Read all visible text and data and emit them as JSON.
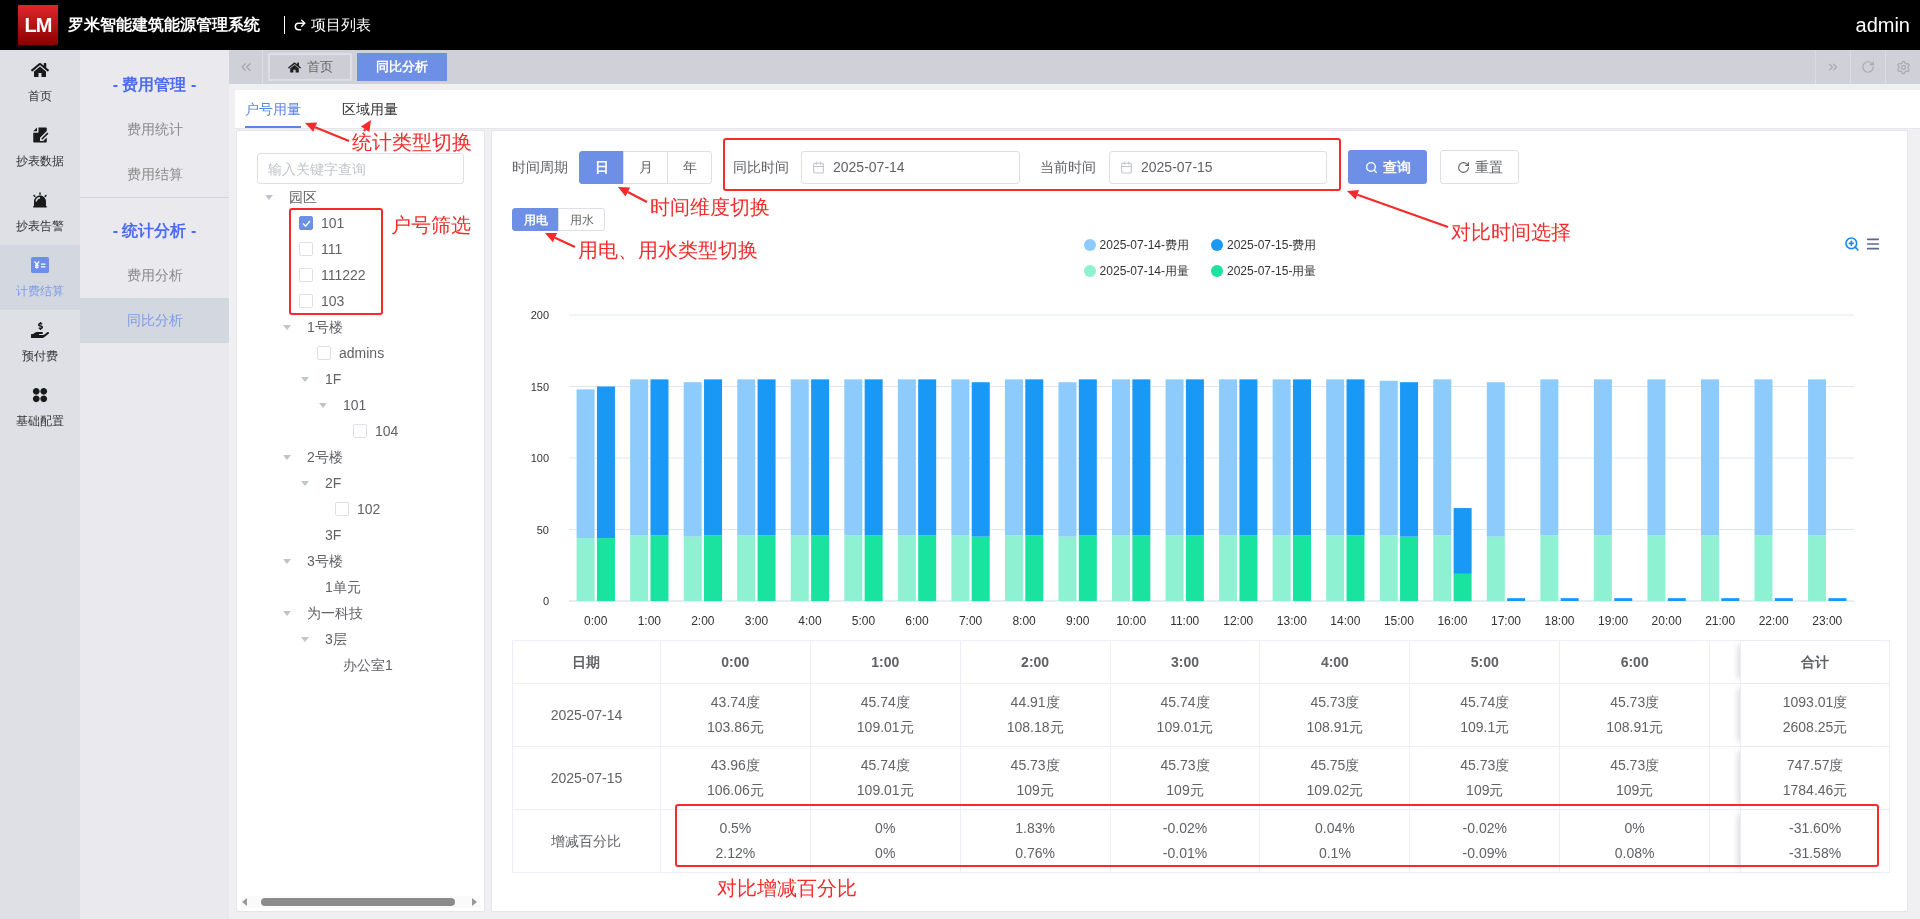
{
  "header": {
    "logo": "LM",
    "title": "罗米智能建筑能源管理系统",
    "project_link": "项目列表",
    "user": "admin"
  },
  "nav": [
    {
      "label": "首页",
      "selected": false
    },
    {
      "label": "抄表数据",
      "selected": false
    },
    {
      "label": "抄表告警",
      "selected": false
    },
    {
      "label": "计费结算",
      "selected": true
    },
    {
      "label": "预付费",
      "selected": false
    },
    {
      "label": "基础配置",
      "selected": false
    }
  ],
  "subnav": [
    {
      "heading": "- 费用管理 -",
      "items": [
        {
          "label": "费用统计",
          "selected": false
        },
        {
          "label": "费用结算",
          "selected": false
        }
      ]
    },
    {
      "heading": "- 统计分析 -",
      "items": [
        {
          "label": "费用分析",
          "selected": false
        },
        {
          "label": "同比分析",
          "selected": true
        }
      ]
    }
  ],
  "tab_bar": {
    "tabs": [
      {
        "label": "首页",
        "selected": false
      },
      {
        "label": "同比分析",
        "selected": true
      }
    ]
  },
  "view_tabs": [
    {
      "label": "户号用量",
      "selected": true
    },
    {
      "label": "区域用量",
      "selected": false
    }
  ],
  "tree": {
    "search": {
      "placeholder": "输入关键字查询"
    },
    "nodes": [
      {
        "label": "园区",
        "kind": "group",
        "expanded": true,
        "children": [
          {
            "label": "101",
            "kind": "unit",
            "checked": true
          },
          {
            "label": "111",
            "kind": "unit",
            "checked": false
          },
          {
            "label": "111222",
            "kind": "unit",
            "checked": false
          },
          {
            "label": "103",
            "kind": "unit",
            "checked": false
          },
          {
            "label": "1号楼",
            "kind": "group",
            "expanded": true,
            "children": [
              {
                "label": "admins",
                "kind": "unit",
                "checked": false
              },
              {
                "label": "1F",
                "kind": "group",
                "expanded": true,
                "children": [
                  {
                    "label": "101",
                    "kind": "group",
                    "expanded": true,
                    "children": [
                      {
                        "label": "104",
                        "kind": "unit",
                        "checked": false
                      }
                    ]
                  }
                ]
              }
            ]
          },
          {
            "label": "2号楼",
            "kind": "group",
            "expanded": true,
            "children": [
              {
                "label": "2F",
                "kind": "group",
                "expanded": true,
                "children": [
                  {
                    "label": "102",
                    "kind": "unit",
                    "checked": false
                  }
                ]
              },
              {
                "label": "3F",
                "kind": "group"
              }
            ]
          },
          {
            "label": "3号楼",
            "kind": "group",
            "expanded": true,
            "children": [
              {
                "label": "1单元",
                "kind": "group"
              }
            ]
          },
          {
            "label": "为一科技",
            "kind": "group",
            "expanded": true,
            "children": [
              {
                "label": "3层",
                "kind": "group",
                "expanded": true,
                "children": [
                  {
                    "label": "办公室1",
                    "kind": "group"
                  }
                ]
              }
            ]
          }
        ]
      }
    ]
  },
  "filters": {
    "period_label": "时间周期",
    "periods": [
      {
        "label": "日",
        "selected": true
      },
      {
        "label": "月",
        "selected": false
      },
      {
        "label": "年",
        "selected": false
      }
    ],
    "compare_label": "同比时间",
    "compare_date": "2025-07-14",
    "current_label": "当前时间",
    "current_date": "2025-07-15",
    "query_button": "查询",
    "reset_button": "重置",
    "energy_types": [
      {
        "label": "用电",
        "selected": true
      },
      {
        "label": "用水",
        "selected": false
      }
    ]
  },
  "chart": {
    "chart_data": {
      "type": "bar",
      "stacked": true,
      "legend": "top",
      "grid": true,
      "x": [
        -0.19,
        0.19,
        0.81,
        1.19,
        1.81,
        2.19,
        2.81,
        3.19,
        3.81,
        4.19,
        4.81,
        5.19,
        5.81,
        6.19,
        6.81,
        7.19,
        7.81,
        8.19,
        8.81,
        9.19,
        9.81,
        10.19,
        10.81,
        11.19,
        11.81,
        12.19,
        12.81,
        13.19,
        13.81,
        14.19,
        14.81,
        15.19,
        15.81,
        16.19,
        16.81,
        17.19,
        17.81,
        18.19,
        18.81,
        19.19,
        19.81,
        20.19,
        20.81,
        21.19,
        21.81,
        22.19,
        22.81,
        23.19
      ],
      "xlim": [
        -0.5,
        23.5
      ],
      "xticks": [
        {
          "value": 0,
          "label": "0:00"
        },
        {
          "value": 1,
          "label": "1:00"
        },
        {
          "value": 2,
          "label": "2:00"
        },
        {
          "value": 3,
          "label": "3:00"
        },
        {
          "value": 4,
          "label": "4:00"
        },
        {
          "value": 5,
          "label": "5:00"
        },
        {
          "value": 6,
          "label": "6:00"
        },
        {
          "value": 7,
          "label": "7:00"
        },
        {
          "value": 8,
          "label": "8:00"
        },
        {
          "value": 9,
          "label": "9:00"
        },
        {
          "value": 10,
          "label": "10:00"
        },
        {
          "value": 11,
          "label": "11:00"
        },
        {
          "value": 12,
          "label": "12:00"
        },
        {
          "value": 13,
          "label": "13:00"
        },
        {
          "value": 14,
          "label": "14:00"
        },
        {
          "value": 15,
          "label": "15:00"
        },
        {
          "value": 16,
          "label": "16:00"
        },
        {
          "value": 17,
          "label": "17:00"
        },
        {
          "value": 18,
          "label": "18:00"
        },
        {
          "value": 19,
          "label": "19:00"
        },
        {
          "value": 20,
          "label": "20:00"
        },
        {
          "value": 21,
          "label": "21:00"
        },
        {
          "value": 22,
          "label": "22:00"
        },
        {
          "value": 23,
          "label": "23:00"
        }
      ],
      "series": [
        {
          "name": "2025-07-14-用量",
          "color": "#8ef1d2",
          "values": [
            44,
            null,
            46,
            null,
            45,
            null,
            46,
            null,
            46,
            null,
            46,
            null,
            46,
            null,
            46,
            null,
            46,
            null,
            45,
            null,
            46,
            null,
            46,
            null,
            46,
            null,
            46,
            null,
            46,
            null,
            46,
            null,
            46,
            null,
            45,
            null,
            46,
            null,
            46,
            null,
            46,
            null,
            46,
            null,
            46,
            null,
            46,
            null
          ]
        },
        {
          "name": "2025-07-15-用量",
          "color": "#19e39f",
          "values": [
            null,
            44,
            null,
            46,
            null,
            46,
            null,
            46,
            null,
            46,
            null,
            46,
            null,
            46,
            null,
            45,
            null,
            46,
            null,
            46,
            null,
            46,
            null,
            46,
            null,
            46,
            null,
            46,
            null,
            46,
            null,
            45,
            null,
            19,
            null,
            0,
            null,
            0,
            null,
            0,
            null,
            0,
            null,
            0,
            null,
            0,
            null,
            0
          ]
        },
        {
          "name": "2025-07-14-费用",
          "color": "#8ccbfb",
          "values": [
            104,
            null,
            109,
            null,
            108,
            null,
            109,
            null,
            109,
            null,
            109,
            null,
            109,
            null,
            109,
            null,
            109,
            null,
            108,
            null,
            109,
            null,
            109,
            null,
            109,
            null,
            109,
            null,
            109,
            null,
            108,
            null,
            109,
            null,
            108,
            null,
            109,
            null,
            109,
            null,
            109,
            null,
            109,
            null,
            109,
            null,
            109,
            null
          ]
        },
        {
          "name": "2025-07-15-费用",
          "color": "#1a98f5",
          "values": [
            null,
            106,
            null,
            109,
            null,
            109,
            null,
            109,
            null,
            109,
            null,
            109,
            null,
            109,
            null,
            108,
            null,
            109,
            null,
            109,
            null,
            109,
            null,
            109,
            null,
            109,
            null,
            109,
            null,
            109,
            null,
            108,
            null,
            46,
            null,
            2,
            null,
            2,
            null,
            2,
            null,
            2,
            null,
            2,
            null,
            2,
            null,
            2
          ]
        }
      ],
      "ylim": [
        0,
        200
      ],
      "yticks": [
        0,
        50,
        100,
        150,
        200
      ]
    }
  },
  "table": {
    "columns": [
      "日期",
      "0:00",
      "1:00",
      "2:00",
      "3:00",
      "4:00",
      "5:00",
      "6:00",
      "合计"
    ],
    "rows": [
      {
        "cells": [
          "2025-07-14",
          "43.74度\n103.86元",
          "45.74度\n109.01元",
          "44.91度\n108.18元",
          "45.74度\n109.01元",
          "45.73度\n108.91元",
          "45.74度\n109.1元",
          "45.73度\n108.91元",
          "1093.01度\n2608.25元"
        ]
      },
      {
        "cells": [
          "2025-07-15",
          "43.96度\n106.06元",
          "45.74度\n109.01元",
          "45.73度\n109元",
          "45.73度\n109元",
          "45.75度\n109.02元",
          "45.73度\n109元",
          "45.73度\n109元",
          "747.57度\n1784.46元"
        ]
      },
      {
        "cells": [
          "增减百分比",
          "0.5%\n2.12%",
          "0%\n0%",
          "1.83%\n0.76%",
          "-0.02%\n-0.01%",
          "0.04%\n0.1%",
          "-0.02%\n-0.09%",
          "0%\n0.08%",
          "-31.60%\n-31.58%"
        ]
      }
    ]
  },
  "annotations": [
    {
      "text": "统计类型切换"
    },
    {
      "text": "户号筛选"
    },
    {
      "text": "时间维度切换"
    },
    {
      "text": "用电、用水类型切换"
    },
    {
      "text": "对比时间选择"
    },
    {
      "text": "对比增减百分比"
    }
  ]
}
